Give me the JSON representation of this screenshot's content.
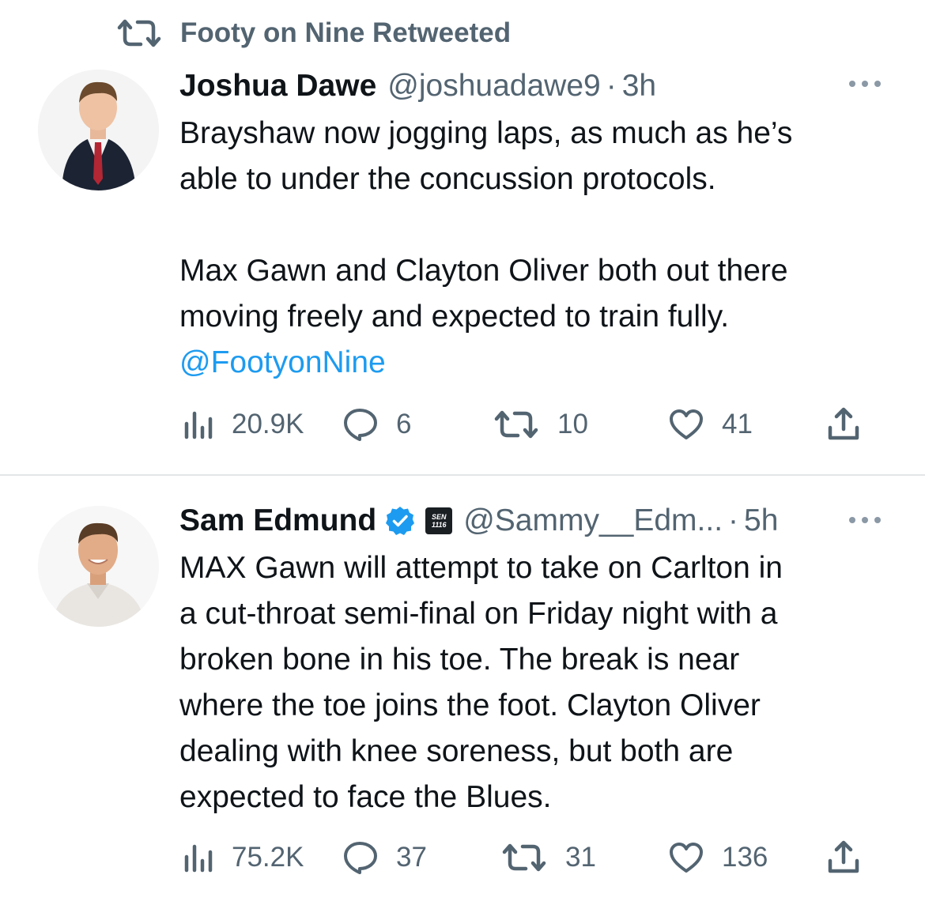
{
  "colors": {
    "text_primary": "#0f1419",
    "text_secondary": "#536471",
    "link": "#1d9bf0",
    "verified": "#1d9bf0",
    "divider": "#e3e6e8"
  },
  "tweets": [
    {
      "retweeted_by": "Footy on Nine Retweeted",
      "author_name": "Joshua Dawe",
      "handle": "@joshuadawe9",
      "separator": "·",
      "time": "3h",
      "verified": false,
      "text_lines": [
        "Brayshaw now jogging laps, as much as he’s",
        "able to under the concussion protocols.",
        "",
        "Max Gawn and Clayton Oliver both out there",
        "moving freely and expected to train fully."
      ],
      "mention": "@FootyonNine",
      "metrics": {
        "views": "20.9K",
        "replies": "6",
        "retweets": "10",
        "likes": "41"
      }
    },
    {
      "author_name": "Sam Edmund",
      "verified": true,
      "org_badge": "SEN 1116",
      "handle": "@Sammy__Edm...",
      "separator": "·",
      "time": "5h",
      "text_lines": [
        "MAX Gawn will attempt to take on Carlton in",
        "a cut-throat semi-final on Friday night with a",
        "broken bone in his toe. The break is near",
        "where the toe joins the foot. Clayton Oliver",
        "dealing with knee soreness, but both are",
        "expected to face the Blues."
      ],
      "metrics": {
        "views": "75.2K",
        "replies": "37",
        "retweets": "31",
        "likes": "136"
      }
    }
  ]
}
